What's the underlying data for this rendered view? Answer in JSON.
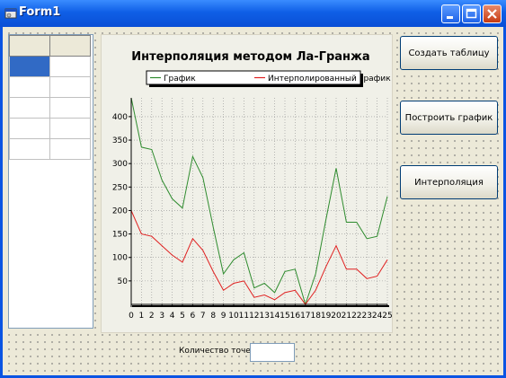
{
  "window": {
    "title": "Form1"
  },
  "buttons": {
    "create_table": "Создать таблицу",
    "build_chart": "Построить график",
    "interpolate": "Интерполяция"
  },
  "points_count": {
    "label": "Количество точек:",
    "value": ""
  },
  "table": {
    "columns": 2,
    "rows": 5,
    "selected_row": 0,
    "selected_col": 0
  },
  "colors": {
    "series_original": "#2e8b2e",
    "series_interpolated": "#e02020",
    "title_bar": "#0a54e3"
  },
  "chart_data": {
    "type": "line",
    "title": "Интерполяция методом Ла-Гранжа",
    "legend_position": "top",
    "grid": true,
    "xlim": [
      0,
      25
    ],
    "ylim": [
      0,
      440
    ],
    "x": [
      0,
      1,
      2,
      3,
      4,
      5,
      6,
      7,
      8,
      9,
      10,
      11,
      12,
      13,
      14,
      15,
      16,
      17,
      18,
      19,
      20,
      21,
      22,
      23,
      24,
      25
    ],
    "x_ticks": [
      0,
      1,
      2,
      3,
      4,
      5,
      6,
      7,
      8,
      9,
      10,
      11,
      12,
      13,
      14,
      15,
      16,
      17,
      18,
      19,
      20,
      21,
      22,
      23,
      24,
      25
    ],
    "y_ticks": [
      50,
      100,
      150,
      200,
      250,
      300,
      350,
      400
    ],
    "series": [
      {
        "name": "График",
        "color": "#2e8b2e",
        "values": [
          440,
          335,
          330,
          265,
          225,
          205,
          315,
          270,
          165,
          65,
          95,
          110,
          35,
          45,
          25,
          70,
          75,
          0,
          65,
          180,
          290,
          175,
          175,
          140,
          145,
          230
        ]
      },
      {
        "name": "Интерполированный график",
        "color": "#e02020",
        "values": [
          200,
          150,
          145,
          125,
          105,
          90,
          140,
          115,
          70,
          30,
          45,
          50,
          15,
          20,
          10,
          25,
          30,
          0,
          30,
          80,
          125,
          75,
          75,
          55,
          60,
          95
        ]
      }
    ]
  }
}
